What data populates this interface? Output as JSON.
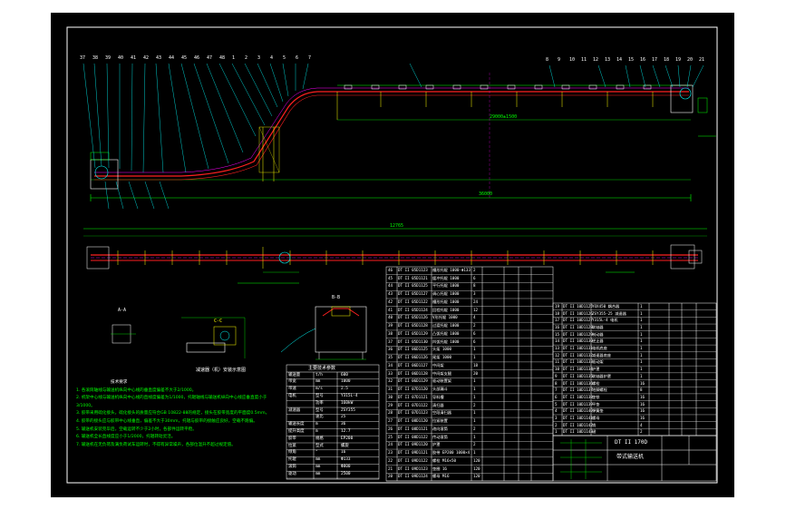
{
  "colors": {
    "background": "#000000",
    "page": "#ffffff",
    "border": "#ffffff",
    "conveyor": "#ff2020",
    "leaders": "#00ffff",
    "dimension": "#00ff00",
    "structure": "#ffff00",
    "accent": "#ff00ff"
  },
  "labels": {
    "section_a": "A-A",
    "section_b": "B-B",
    "section_c": "C-C",
    "detail_caption": "减速器（机）安装示意图",
    "param_table_title": "主要技术参数",
    "title_block_code": "DT II 170D",
    "title_block_name": "带式输送机",
    "dim_total": "36000",
    "dim_mid": "29000±1500",
    "dim_plan": "12765"
  },
  "notes": {
    "title": "技术要求",
    "lines": [
      "1. 各滚筒轴线与输送机纵向中心线的垂直度偏差不大于2/1000。",
      "2. 机架中心线与输送机纵向中心线的直线度偏差为1/1000，托辊轴线与输送机纵向中心线应垂直度小于3/1000。",
      "3. 胶带采用硫化接头，硫化接头的质量应符合GB 10822-88的规定，接头在胶带宽度的平面度0.5mm。",
      "4. 胶带的接头应与胶带中心线垂直，偏差不大于30mm，托辊与胶带的接触应良好，空载不跑偏。",
      "5. 输送机安装完毕后，空载运转不少于2小时，各部件运转平稳。",
      "6. 输送机全长直线度应小于1/2000，托辊转动灵活。",
      "7. 输送机在无负荷及满负荷试车运转时，不得有异常噪声，各部位温升不超过规定值。"
    ]
  },
  "balloons_top": [
    "37",
    "38",
    "39",
    "40",
    "41",
    "42",
    "43",
    "44",
    "45",
    "46",
    "47",
    "48",
    "1",
    "2",
    "3",
    "4",
    "5",
    "6",
    "7"
  ],
  "balloons_right": [
    "8",
    "9",
    "10",
    "11",
    "12",
    "13",
    "14",
    "15",
    "16",
    "17",
    "18",
    "19",
    "20",
    "21"
  ],
  "params": [
    [
      "输送量",
      "t/h",
      "600"
    ],
    [
      "带宽",
      "mm",
      "1000"
    ],
    [
      "带速",
      "m/s",
      "2.5"
    ],
    [
      "电机",
      "型号",
      "Y315L-4"
    ],
    [
      "",
      "功率",
      "160kW"
    ],
    [
      "减速器",
      "型号",
      "ZSY355"
    ],
    [
      "",
      "速比",
      "25"
    ],
    [
      "输送长度",
      "m",
      "36"
    ],
    [
      "提升高度",
      "m",
      "12.7"
    ],
    [
      "胶带",
      "规格",
      "EP200"
    ],
    [
      "拉紧",
      "型式",
      "螺旋"
    ],
    [
      "倾角",
      "°",
      "16"
    ],
    [
      "托辊",
      "mm",
      "Φ133"
    ],
    [
      "滚筒",
      "mm",
      "Φ800"
    ],
    [
      "驱动",
      "mm",
      "2500"
    ]
  ],
  "bom_left": [
    [
      "46",
      "DT II 05D1123",
      "槽形托辊 1000-Φ133",
      "2"
    ],
    [
      "45",
      "DT II 05D1121",
      "缓冲托辊 1000",
      "6"
    ],
    [
      "44",
      "DT II 05D1125",
      "平行托辊 1000",
      "8"
    ],
    [
      "43",
      "DT II 05D1127",
      "调心托辊 1000",
      "3"
    ],
    [
      "42",
      "DT II 05D1122",
      "槽形托辊 1000",
      "24"
    ],
    [
      "41",
      "DT II 05D1124",
      "回程托辊 1000",
      "12"
    ],
    [
      "40",
      "DT II 05D1126",
      "V形托辊 1000",
      "4"
    ],
    [
      "39",
      "DT II 05D1128",
      "过渡托辊 1000",
      "2"
    ],
    [
      "38",
      "DT II 05D1129",
      "凸弧托辊 1000",
      "6"
    ],
    [
      "37",
      "DT II 05D1130",
      "凹弧托辊 1000",
      "6"
    ],
    [
      "36",
      "DT II 06D1125",
      "头架 1000",
      "1"
    ],
    [
      "35",
      "DT II 06D1126",
      "尾架 1000",
      "1"
    ],
    [
      "34",
      "DT II 06D1127",
      "中间架",
      "18"
    ],
    [
      "33",
      "DT II 06D1128",
      "中间架支腿",
      "20"
    ],
    [
      "32",
      "DT II 06D1129",
      "驱动装置架",
      "1"
    ],
    [
      "31",
      "DT II 07D1120",
      "头部漏斗",
      "1"
    ],
    [
      "30",
      "DT II 07D1121",
      "导料槽",
      "1"
    ],
    [
      "29",
      "DT II 07D1122",
      "清扫器",
      "2"
    ],
    [
      "28",
      "DT II 07D1123",
      "空段清扫器",
      "1"
    ],
    [
      "27",
      "DT II 08D1120",
      "拉紧装置",
      "1"
    ],
    [
      "26",
      "DT II 08D1121",
      "改向滚筒",
      "2"
    ],
    [
      "25",
      "DT II 08D1122",
      "传动滚筒",
      "1"
    ],
    [
      "24",
      "DT II 09D1120",
      "护罩",
      "2"
    ],
    [
      "23",
      "DT II 09D1121",
      "胶带 EP200 1000×4",
      "1"
    ],
    [
      "22",
      "DT II 09D1122",
      "螺栓 M16×50",
      "120"
    ],
    [
      "21",
      "DT II 09D1123",
      "垫圈 16",
      "120"
    ],
    [
      "20",
      "DT II 09D1124",
      "螺母 M16",
      "120"
    ]
  ],
  "bom_right": [
    [
      "19",
      "DT II 10D1125",
      "YOX450 耦合器",
      "1"
    ],
    [
      "18",
      "DT II 10D1126",
      "ZSY355-25 减速器",
      "1"
    ],
    [
      "17",
      "DT II 10D1127",
      "Y315L-4 电机",
      "1"
    ],
    [
      "16",
      "DT II 10D1128",
      "联轴器",
      "1"
    ],
    [
      "15",
      "DT II 10D1129",
      "制动器",
      "1"
    ],
    [
      "14",
      "DT II 10D1130",
      "逆止器",
      "1"
    ],
    [
      "13",
      "DT II 10D1131",
      "电机底座",
      "1"
    ],
    [
      "12",
      "DT II 10D1132",
      "减速器底座",
      "1"
    ],
    [
      "11",
      "DT II 10D1133",
      "驱动架",
      "1"
    ],
    [
      "10",
      "DT II 10D1134",
      "护罩",
      "1"
    ],
    [
      "9",
      "DT II 10D1135",
      "联轴器护罩",
      "1"
    ],
    [
      "8",
      "DT II 10D1136",
      "螺栓",
      "16"
    ],
    [
      "7",
      "DT II 10D1137",
      "地脚螺栓",
      "8"
    ],
    [
      "6",
      "DT II 10D1138",
      "垫铁",
      "16"
    ],
    [
      "5",
      "DT II 10D1139",
      "平垫",
      "16"
    ],
    [
      "4",
      "DT II 10D1140",
      "弹簧垫",
      "16"
    ],
    [
      "3",
      "DT II 10D1141",
      "螺母",
      "16"
    ],
    [
      "2",
      "DT II 10D1142",
      "销",
      "4"
    ],
    [
      "1",
      "DT II 10D1143",
      "键",
      "2"
    ]
  ]
}
